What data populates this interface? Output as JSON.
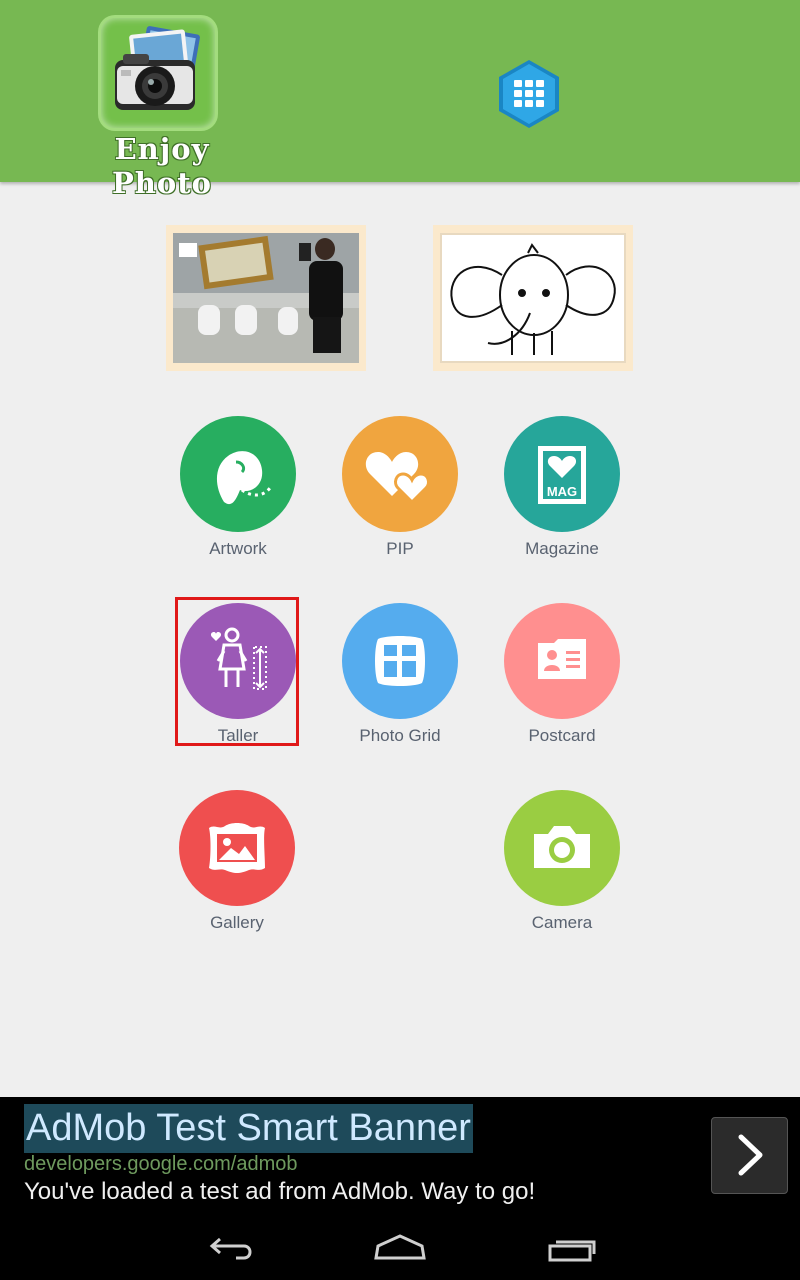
{
  "header": {
    "app_title": "Enjoy Photo",
    "logo_icon": "camera-photos-icon",
    "menu_icon": "grid-menu-icon"
  },
  "thumbnails": [
    {
      "name": "photo-frame-thumbnail"
    },
    {
      "name": "elephant-sketch-thumbnail"
    }
  ],
  "menu": {
    "items": [
      {
        "label": "Artwork",
        "icon": "artwork-icon",
        "color": "#27ae60"
      },
      {
        "label": "PIP",
        "icon": "hearts-icon",
        "color": "#f0a53f"
      },
      {
        "label": "Magazine",
        "icon": "magazine-icon",
        "color": "#26a69a"
      },
      {
        "label": "Taller",
        "icon": "taller-icon",
        "color": "#9b59b6"
      },
      {
        "label": "Photo Grid",
        "icon": "photo-grid-icon",
        "color": "#55acee"
      },
      {
        "label": "Postcard",
        "icon": "postcard-icon",
        "color": "#ff8f8f"
      },
      {
        "label": "Gallery",
        "icon": "gallery-icon",
        "color": "#ef4f4f"
      },
      {
        "label": "Camera",
        "icon": "camera-icon",
        "color": "#9acd42"
      }
    ],
    "selected": "Taller"
  },
  "ad": {
    "title": "AdMob Test Smart Banner",
    "url": "developers.google.com/admob",
    "text": "You've loaded a test ad from AdMob. Way to go!"
  },
  "navbar": {
    "back_icon": "back-icon",
    "home_icon": "home-icon",
    "recents_icon": "recents-icon"
  },
  "colors": {
    "header": "#77b852",
    "background": "#efefef",
    "highlight": "#e01919"
  }
}
